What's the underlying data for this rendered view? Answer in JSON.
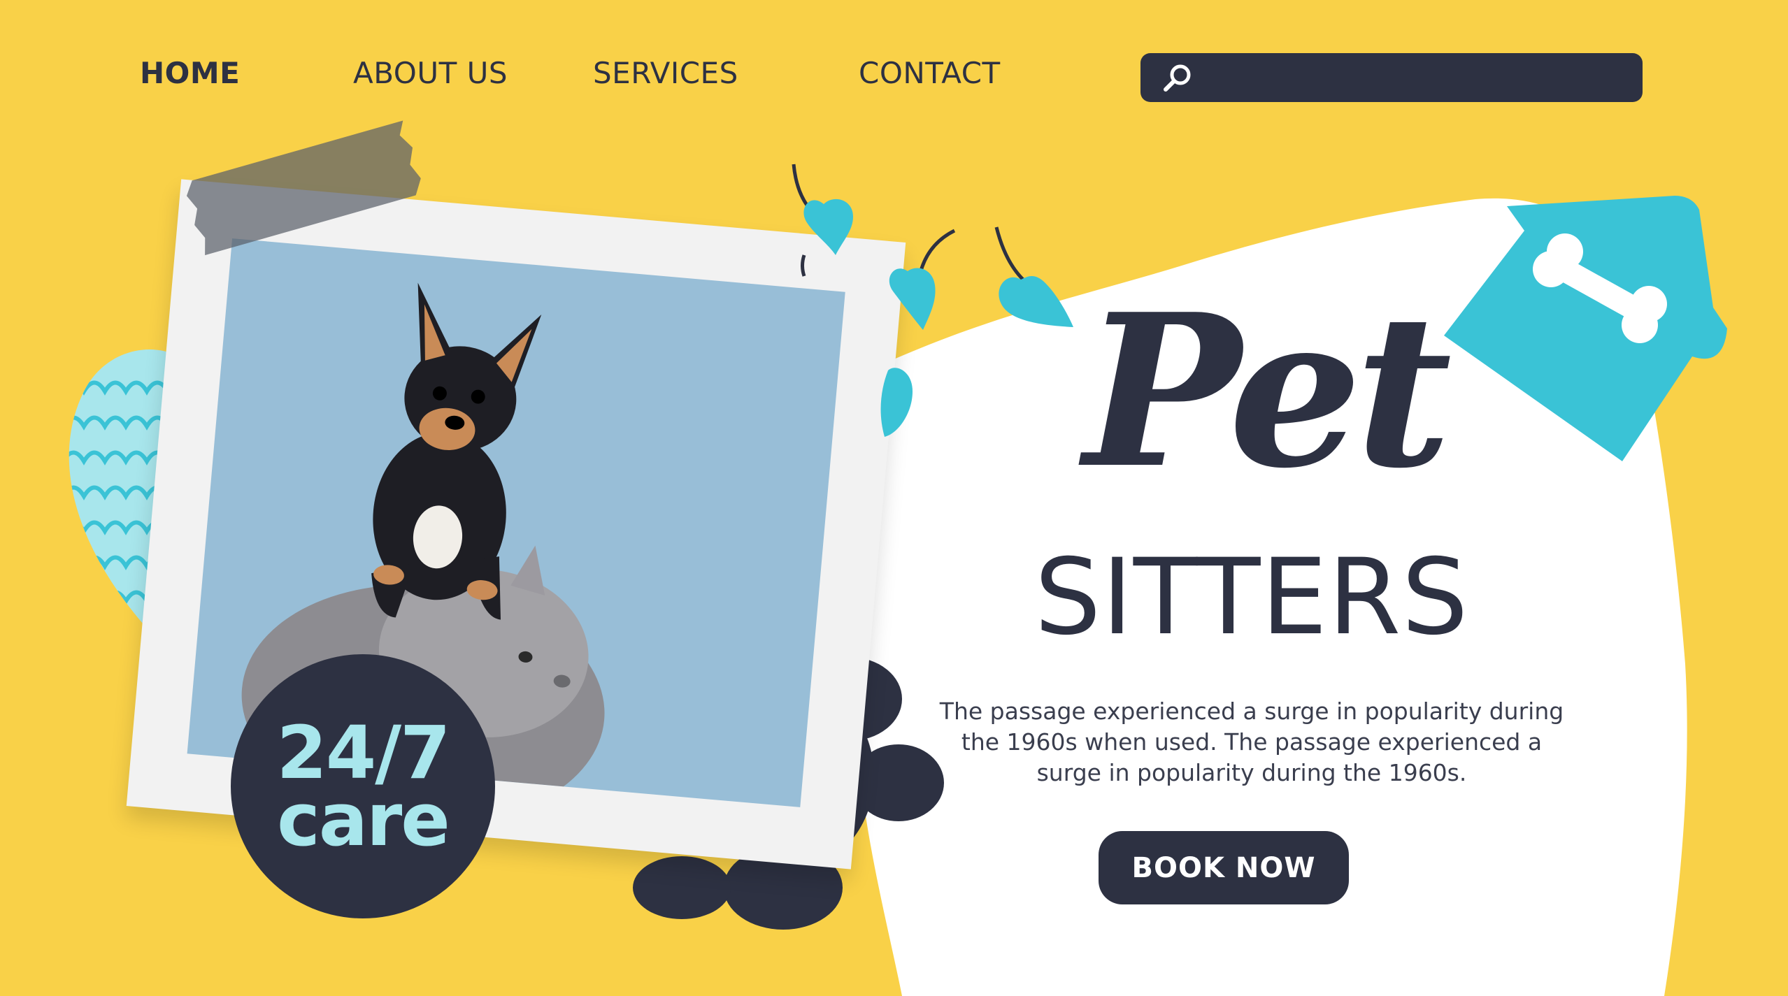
{
  "nav": {
    "items": [
      {
        "label": "HOME",
        "active": true
      },
      {
        "label": "ABOUT US",
        "active": false
      },
      {
        "label": "SERVICES",
        "active": false
      },
      {
        "label": "CONTACT",
        "active": false
      }
    ]
  },
  "search": {
    "placeholder": "",
    "value": "",
    "icon": "search-icon"
  },
  "hero": {
    "script_title": "Pet",
    "title": "SITTERS",
    "description": "The passage experienced a surge in popularity during the 1960s when used. The passage experienced a surge in popularity during the 1960s.",
    "cta_label": "BOOK NOW"
  },
  "badge": {
    "line1": "24/7",
    "line2": "care"
  },
  "colors": {
    "background": "#F9D148",
    "dark": "#2D3142",
    "accent": "#3AC3D6",
    "light_accent": "#A8E6EC",
    "white": "#FFFFFF"
  },
  "icons": [
    "search-icon",
    "bone-icon",
    "doghouse-icon",
    "heart-icon",
    "paw-print-icon"
  ]
}
